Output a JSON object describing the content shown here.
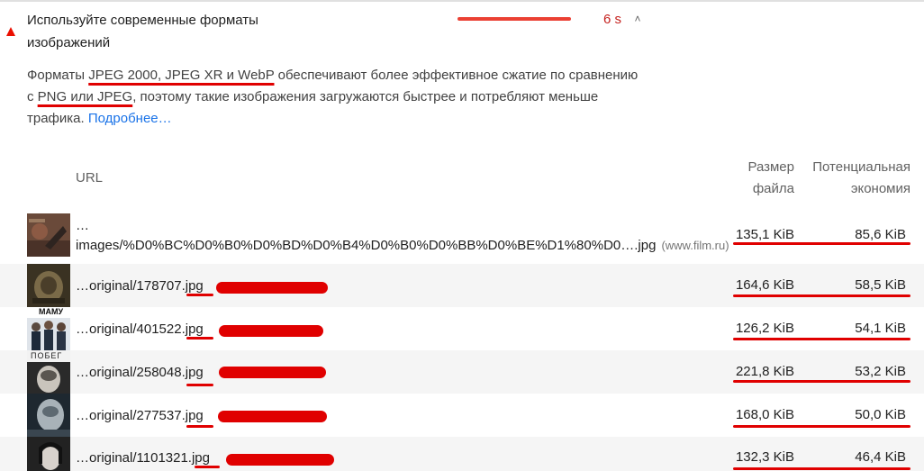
{
  "audit": {
    "title": "Используйте современные форматы изображений",
    "savings_time": "6 s",
    "status_color": "#eb0f00",
    "chevron": "˄",
    "description_parts": {
      "p1": "Форматы ",
      "formats": "JPEG 2000, JPEG XR и WebP",
      "p2": " обеспечивают более эффективное сжатие по сравнению с ",
      "old_formats": "PNG или JPEG",
      "p3": ", поэтому такие изображения загружаются быстрее и потребляют меньше трафика. ",
      "learn_more": "Подробнее…"
    }
  },
  "table": {
    "col_url": "URL",
    "col_size": "Размер файла",
    "col_savings": "Потенциальная экономия",
    "rows": [
      {
        "url_line1": "…",
        "url": "images/%D0%BC%D0%B0%D0%BD%D0%B4%D0%B0%D0%BB%D0%BE%D1%80%D0….jpg",
        "host": "(www.film.ru)",
        "size": "135,1 KiB",
        "savings": "85,6 KiB"
      },
      {
        "url": "…original/178707.jpg",
        "size": "164,6 KiB",
        "savings": "58,5 KiB"
      },
      {
        "url": "…original/401522.jpg",
        "size": "126,2 KiB",
        "savings": "54,1 KiB"
      },
      {
        "url": "…original/258048.jpg",
        "size": "221,8 KiB",
        "savings": "53,2 KiB"
      },
      {
        "url": "…original/277537.jpg",
        "size": "168,0 KiB",
        "savings": "50,0 KiB"
      },
      {
        "url": "…original/1101321.jpg",
        "size": "132,3 KiB",
        "savings": "46,4 KiB"
      }
    ],
    "thumb_captions": {
      "row3": "МАМУ",
      "row4": "ПОБЕГ"
    }
  },
  "colors": {
    "accent_red": "#e00000",
    "link_blue": "#1a73e8",
    "row_shade": "#f5f5f5"
  }
}
